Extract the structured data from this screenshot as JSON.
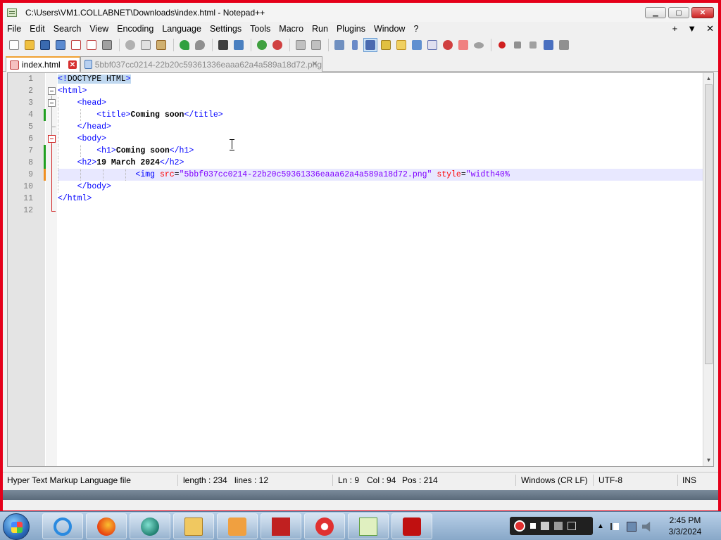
{
  "window": {
    "title": "C:\\Users\\VM1.COLLABNET\\Downloads\\index.html - Notepad++",
    "minimize": "▁",
    "maximize": "▢",
    "close": "✕"
  },
  "menu": {
    "items": [
      "File",
      "Edit",
      "Search",
      "View",
      "Encoding",
      "Language",
      "Settings",
      "Tools",
      "Macro",
      "Run",
      "Plugins",
      "Window",
      "?"
    ],
    "right": [
      "+",
      "▼",
      "✕"
    ]
  },
  "toolbar": {
    "buttons": [
      "new-file-icon",
      "open-file-icon",
      "save-icon",
      "save-all-icon",
      "close-icon",
      "close-all-icon",
      "print-icon",
      "cut-icon",
      "copy-icon",
      "paste-icon",
      "undo-icon",
      "redo-icon",
      "find-icon",
      "replace-icon",
      "zoom-in-icon",
      "zoom-out-icon",
      "sync-vertical-icon",
      "sync-horizontal-icon",
      "word-wrap-icon",
      "show-all-chars-icon",
      "indent-guide-icon",
      "udl-icon",
      "doc-map-icon",
      "function-list-icon",
      "folder-workspace-icon",
      "monitoring-icon",
      "record-macro-icon",
      "stop-record-icon",
      "play-macro-icon",
      "run-macro-multiple-icon",
      "save-macro-icon"
    ]
  },
  "tabs": [
    {
      "label": "index.html",
      "active": true
    },
    {
      "label": "5bbf037cc0214-22b20c59361336eaaa62a4a589a18d72.png",
      "active": false
    }
  ],
  "editor": {
    "line_numbers": [
      "1",
      "2",
      "3",
      "4",
      "5",
      "6",
      "7",
      "8",
      "9",
      "10",
      "11",
      "12"
    ],
    "lines": {
      "l1": {
        "open": "<!",
        "doctype": "DOCTYPE HTML",
        "close": ">"
      },
      "l2": {
        "tag": "<html>"
      },
      "l3": {
        "tag": "<head>"
      },
      "l4": {
        "open": "<title>",
        "text": "Coming soon",
        "close": "</title>"
      },
      "l5": {
        "tag": "</head>"
      },
      "l6": {
        "tag": "<body>"
      },
      "l7": {
        "open": "<h1>",
        "text": "Coming soon",
        "close": "</h1>"
      },
      "l8": {
        "open": "<h2>",
        "text": "19 March 2024",
        "close": "</h2>"
      },
      "l9": {
        "tag": "<img",
        "attr1": "src",
        "eq1": "=",
        "val1": "\"5bbf037cc0214-22b20c59361336eaaa62a4a589a18d72.png\"",
        "attr2": "style",
        "eq2": "=",
        "val2": "\"width40%"
      },
      "l10": {
        "tag": "</body>"
      },
      "l11": {
        "tag": "</html>"
      }
    }
  },
  "status": {
    "file_type": "Hyper Text Markup Language file",
    "length": "length : 234",
    "lines": "lines : 12",
    "ln": "Ln : 9",
    "col": "Col : 94",
    "pos": "Pos : 214",
    "eol": "Windows (CR LF)",
    "encoding": "UTF-8",
    "mode": "INS"
  },
  "taskbar": {
    "apps": [
      "internet-explorer-icon",
      "firefox-icon",
      "app-icon",
      "file-explorer-icon",
      "media-player-icon",
      "filezilla-icon",
      "recorder-icon",
      "notepad-plus-plus-icon",
      "flash-icon"
    ],
    "clock_time": "2:45 PM",
    "clock_date": "3/3/2024"
  },
  "colors": {
    "tag": "#0000ff",
    "attribute": "#ff0000",
    "value": "#8000ff",
    "text": "#000000",
    "current_line": "#e8e8ff",
    "active_tab_accent": "#f0a030",
    "change_marker_saved": "#20a020",
    "change_marker_unsaved": "#f09020"
  }
}
